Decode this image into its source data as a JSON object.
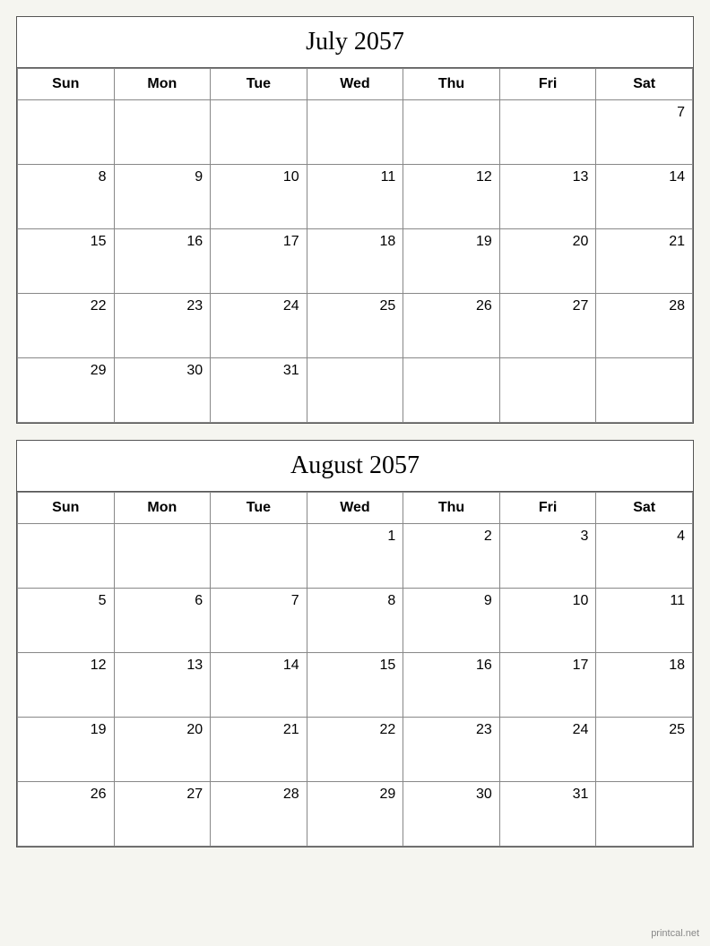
{
  "calendars": [
    {
      "id": "july-2057",
      "title": "July 2057",
      "headers": [
        "Sun",
        "Mon",
        "Tue",
        "Wed",
        "Thu",
        "Fri",
        "Sat"
      ],
      "weeks": [
        [
          "",
          "",
          "",
          "",
          "",
          "",
          ""
        ],
        [
          null,
          null,
          null,
          null,
          null,
          null,
          null
        ],
        [
          null,
          null,
          null,
          null,
          null,
          null,
          null
        ],
        [
          null,
          null,
          null,
          null,
          null,
          null,
          null
        ],
        [
          null,
          null,
          null,
          null,
          null,
          null,
          null
        ],
        [
          null,
          null,
          null,
          null,
          null,
          null,
          null
        ]
      ],
      "days": [
        [
          0,
          0,
          0,
          0,
          0,
          0,
          7
        ],
        [
          8,
          9,
          10,
          11,
          12,
          13,
          14
        ],
        [
          15,
          16,
          17,
          18,
          19,
          20,
          21
        ],
        [
          22,
          23,
          24,
          25,
          26,
          27,
          28
        ],
        [
          29,
          30,
          31,
          0,
          0,
          0,
          0
        ]
      ],
      "startDay": 1
    },
    {
      "id": "august-2057",
      "title": "August 2057",
      "headers": [
        "Sun",
        "Mon",
        "Tue",
        "Wed",
        "Thu",
        "Fri",
        "Sat"
      ],
      "days": [
        [
          0,
          0,
          0,
          1,
          2,
          3,
          4
        ],
        [
          5,
          6,
          7,
          8,
          9,
          10,
          11
        ],
        [
          12,
          13,
          14,
          15,
          16,
          17,
          18
        ],
        [
          19,
          20,
          21,
          22,
          23,
          24,
          25
        ],
        [
          26,
          27,
          28,
          29,
          30,
          31,
          0
        ]
      ],
      "startDay": 3
    }
  ],
  "watermark": "printcal.net"
}
